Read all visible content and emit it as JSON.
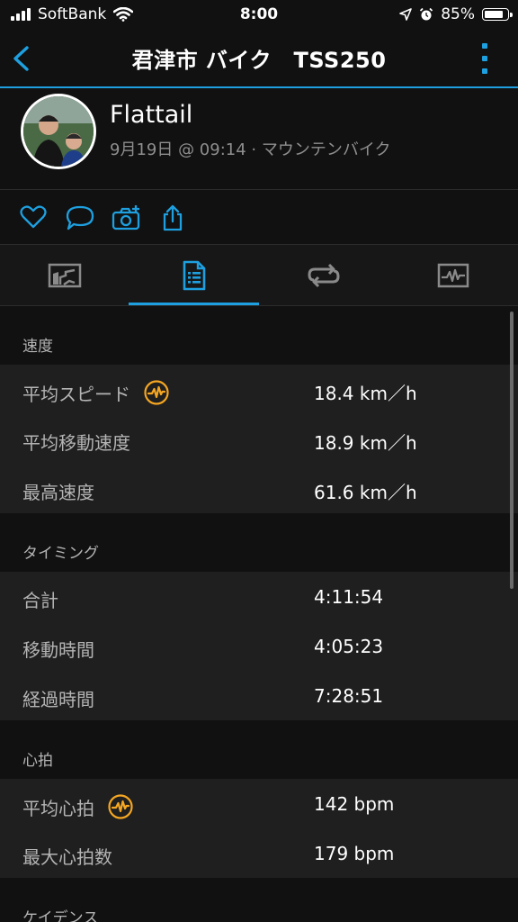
{
  "status_bar": {
    "carrier": "SoftBank",
    "time": "8:00",
    "battery": "85%",
    "battery_level": 0.85
  },
  "nav": {
    "title": "君津市 バイク　TSS250"
  },
  "profile": {
    "name": "Flattail",
    "meta": "9月19日 @ 09:14 · マウンテンバイク"
  },
  "sections": [
    {
      "title": "速度",
      "rows": [
        {
          "label": "平均スピード",
          "value": "18.4 km／h",
          "badge": true
        },
        {
          "label": "平均移動速度",
          "value": "18.9 km／h",
          "badge": false
        },
        {
          "label": "最高速度",
          "value": "61.6 km／h",
          "badge": false
        }
      ]
    },
    {
      "title": "タイミング",
      "rows": [
        {
          "label": "合計",
          "value": "4:11:54",
          "badge": false
        },
        {
          "label": "移動時間",
          "value": "4:05:23",
          "badge": false
        },
        {
          "label": "経過時間",
          "value": "7:28:51",
          "badge": false
        }
      ]
    },
    {
      "title": "心拍",
      "rows": [
        {
          "label": "平均心拍",
          "value": "142 bpm",
          "badge": true
        },
        {
          "label": "最大心拍数",
          "value": "179 bpm",
          "badge": false
        }
      ]
    },
    {
      "title": "ケイデンス",
      "rows": []
    }
  ],
  "colors": {
    "accent": "#1ea0e0",
    "badge": "#f5a623",
    "background": "#111111",
    "row_background": "#1f1f1f"
  }
}
